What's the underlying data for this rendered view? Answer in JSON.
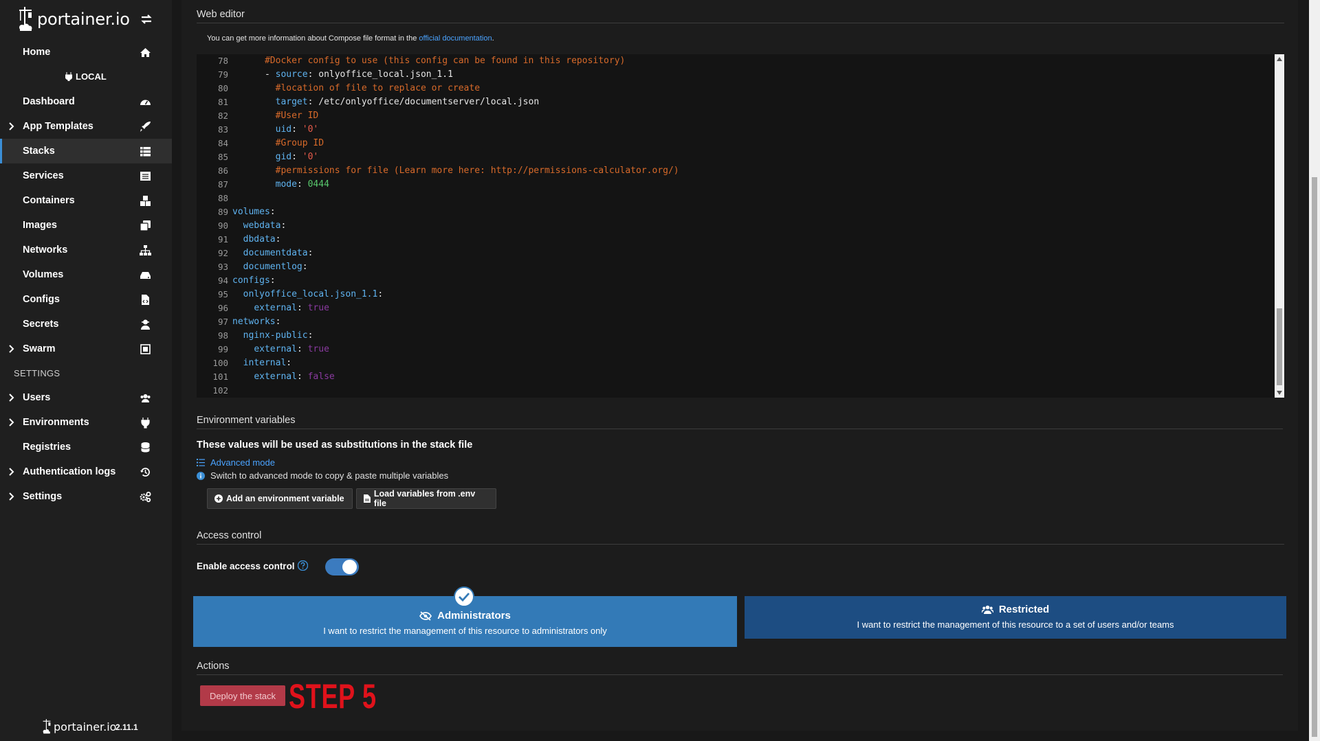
{
  "app": {
    "logo_text": "portainer.io",
    "version": "2.11.1"
  },
  "sidebar": {
    "environment_label": "LOCAL",
    "settings_heading": "SETTINGS",
    "items": [
      {
        "label": "Home",
        "icon": "home-icon"
      },
      {
        "label": "Dashboard",
        "icon": "dashboard-icon"
      },
      {
        "label": "App Templates",
        "icon": "rocket-icon"
      },
      {
        "label": "Stacks",
        "icon": "stacks-icon"
      },
      {
        "label": "Services",
        "icon": "list-icon"
      },
      {
        "label": "Containers",
        "icon": "cubes-icon"
      },
      {
        "label": "Images",
        "icon": "clone-icon"
      },
      {
        "label": "Networks",
        "icon": "sitemap-icon"
      },
      {
        "label": "Volumes",
        "icon": "hdd-icon"
      },
      {
        "label": "Configs",
        "icon": "file-code-icon"
      },
      {
        "label": "Secrets",
        "icon": "user-secret-icon"
      },
      {
        "label": "Swarm",
        "icon": "object-group-icon"
      },
      {
        "label": "Users",
        "icon": "users-icon"
      },
      {
        "label": "Environments",
        "icon": "plug-icon"
      },
      {
        "label": "Registries",
        "icon": "database-icon"
      },
      {
        "label": "Authentication logs",
        "icon": "history-icon"
      },
      {
        "label": "Settings",
        "icon": "cogs-icon"
      }
    ]
  },
  "web_editor": {
    "title": "Web editor",
    "info_prefix": "You can get more information about Compose file format in the",
    "info_link": "official documentation",
    "info_suffix": ".",
    "lines": [
      {
        "n": "78",
        "text": "      #Docker config to use (this config can be found in this repository)"
      },
      {
        "n": "79",
        "text": "      - source: onlyoffice_local.json_1.1"
      },
      {
        "n": "80",
        "text": "        #location of file to replace or create"
      },
      {
        "n": "81",
        "text": "        target: /etc/onlyoffice/documentserver/local.json"
      },
      {
        "n": "82",
        "text": "        #User ID"
      },
      {
        "n": "83",
        "text": "        uid: '0'"
      },
      {
        "n": "84",
        "text": "        #Group ID"
      },
      {
        "n": "85",
        "text": "        gid: '0'"
      },
      {
        "n": "86",
        "text": "        #permissions for file (Learn more here: http://permissions-calculator.org/)"
      },
      {
        "n": "87",
        "text": "        mode: 0444"
      },
      {
        "n": "88",
        "text": ""
      },
      {
        "n": "89",
        "text": "volumes:"
      },
      {
        "n": "90",
        "text": "  webdata:"
      },
      {
        "n": "91",
        "text": "  dbdata:"
      },
      {
        "n": "92",
        "text": "  documentdata:"
      },
      {
        "n": "93",
        "text": "  documentlog:"
      },
      {
        "n": "94",
        "text": "configs:"
      },
      {
        "n": "95",
        "text": "  onlyoffice_local.json_1.1:"
      },
      {
        "n": "96",
        "text": "    external: true"
      },
      {
        "n": "97",
        "text": "networks:"
      },
      {
        "n": "98",
        "text": "  nginx-public:"
      },
      {
        "n": "99",
        "text": "    external: true"
      },
      {
        "n": "100",
        "text": "  internal:"
      },
      {
        "n": "101",
        "text": "    external: false"
      },
      {
        "n": "102",
        "text": ""
      }
    ]
  },
  "env_vars": {
    "title": "Environment variables",
    "description": "These values will be used as substitutions in the stack file",
    "advanced_mode": "Advanced mode",
    "advanced_hint": "Switch to advanced mode to copy & paste multiple variables",
    "add_button": "Add an environment variable",
    "load_button": "Load variables from .env file"
  },
  "access_control": {
    "title": "Access control",
    "toggle_label": "Enable access control",
    "enabled": true,
    "admin_title": "Administrators",
    "admin_desc": "I want to restrict the management of this resource to administrators only",
    "restricted_title": "Restricted",
    "restricted_desc": "I want to restrict the management of this resource to a set of users and/or teams",
    "selected": "Administrators"
  },
  "actions": {
    "title": "Actions",
    "deploy_button": "Deploy the stack",
    "annotation": "STEP 5"
  },
  "colors": {
    "accent": "#337ab7",
    "restricted": "#1d4d82",
    "deploy": "#b23a48",
    "annotation": "#e0121b"
  }
}
